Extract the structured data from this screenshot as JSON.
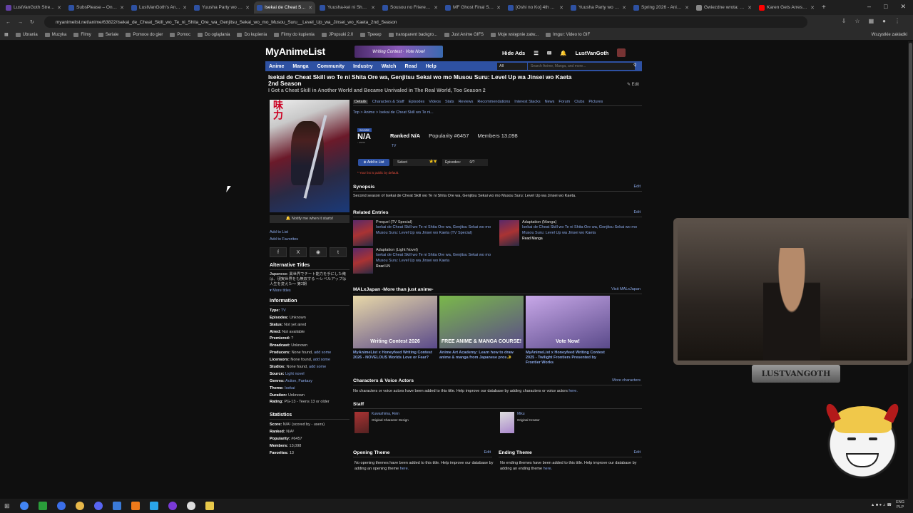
{
  "tabs": [
    {
      "label": "LustVanGoth Strea...",
      "color": "#6441a5"
    },
    {
      "label": "SubsPlease – One ...",
      "color": "#2e51a2"
    },
    {
      "label": "LustVanGoth's Ani...",
      "color": "#2e51a2"
    },
    {
      "label": "Yuusha Party wo C...",
      "color": "#2e51a2"
    },
    {
      "label": "Isekai de Cheat Skil...",
      "color": "#2e51a2",
      "active": true
    },
    {
      "label": "Yuusha-kei ni Shou...",
      "color": "#2e51a2"
    },
    {
      "label": "Sousou no Frieren ...",
      "color": "#2e51a2"
    },
    {
      "label": "MF Ghost Final Sea...",
      "color": "#2e51a2"
    },
    {
      "label": "[Oshi no Ko] 4th Se...",
      "color": "#2e51a2"
    },
    {
      "label": "Yuusha Party wo C...",
      "color": "#2e51a2"
    },
    {
      "label": "Spring 2026 - Anim...",
      "color": "#2e51a2"
    },
    {
      "label": "Gwiezdne wrota: A...",
      "color": "#888888"
    },
    {
      "label": "Karen Gets Arrested...",
      "color": "#ff0000"
    }
  ],
  "browser": {
    "url": "myanimelist.net/anime/63822/Isekai_de_Cheat_Skill_wo_Te_ni_Shita_Ore_wa_Genjitsu_Sekai_wo_mo_Musou_Suru__Level_Up_wa_Jinsei_wo_Kaeta_2nd_Season",
    "bookmarks": [
      "Ubrania",
      "Muzyka",
      "Filmy",
      "Seriale",
      "Pomoce do gier",
      "Pomoc",
      "Do oglądania",
      "Do kupienia",
      "Filmy do kupienia",
      "JPopsuki 2.0",
      "Трекер",
      "transparent backgro...",
      "Just Anime GIFS",
      "Moje wstępnie zatw...",
      "Imgur: Video to GIF"
    ],
    "bookmarks_right": "Wszystkie zakładki"
  },
  "mal": {
    "logo": "MyAnimeList",
    "banner": "Writing Contest · Vote Now!",
    "hide_ads": "Hide Ads",
    "username": "LustVanGoth",
    "nav": [
      "Anime",
      "Manga",
      "Community",
      "Industry",
      "Watch",
      "Read",
      "Help"
    ],
    "search_select": "All",
    "search_placeholder": "Search Anime, Manga, and more...",
    "title": "Isekai de Cheat Skill wo Te ni Shita Ore wa, Genjitsu Sekai wo mo Musou Suru: Level Up wa Jinsei wo Kaeta 2nd Season",
    "english_title": "I Got a Cheat Skill in Another World and Became Unrivaled in The Real World, Too Season 2",
    "edit": "Edit",
    "notify": "Notify me when it starts!",
    "add_to_list": "Add to List",
    "add_to_favorites": "Add to Favorites",
    "alt_titles_heading": "Alternative Titles",
    "japanese_label": "Japanese:",
    "japanese": "異世界でチート能力を手にした俺は、現実世界をも無双する ～レベルアップは人生を変えた～ 第2期",
    "more_titles": "More titles",
    "information_heading": "Information",
    "info": [
      {
        "k": "Type:",
        "v": "TV",
        "link": true
      },
      {
        "k": "Episodes:",
        "v": "Unknown"
      },
      {
        "k": "Status:",
        "v": "Not yet aired"
      },
      {
        "k": "Aired:",
        "v": "Not available"
      },
      {
        "k": "Premiered:",
        "v": "?"
      },
      {
        "k": "Broadcast:",
        "v": "Unknown"
      },
      {
        "k": "Producers:",
        "v": "None found,",
        "extra": "add some"
      },
      {
        "k": "Licensors:",
        "v": "None found,",
        "extra": "add some"
      },
      {
        "k": "Studios:",
        "v": "None found,",
        "extra": "add some"
      },
      {
        "k": "Source:",
        "v": "Light novel",
        "link": true
      },
      {
        "k": "Genres:",
        "v": "Action, Fantasy",
        "link": true
      },
      {
        "k": "Theme:",
        "v": "Isekai",
        "link": true
      },
      {
        "k": "Duration:",
        "v": "Unknown"
      },
      {
        "k": "Rating:",
        "v": "PG-13 - Teens 13 or older"
      }
    ],
    "statistics_heading": "Statistics",
    "statistics": [
      {
        "k": "Score:",
        "v": "N/A¹ (scored by - users)"
      },
      {
        "k": "Ranked:",
        "v": "N/A²"
      },
      {
        "k": "Popularity:",
        "v": "#6457"
      },
      {
        "k": "Members:",
        "v": "13,098"
      },
      {
        "k": "Favorites:",
        "v": "13"
      }
    ],
    "subnav": [
      "Details",
      "Characters & Staff",
      "Episodes",
      "Videos",
      "Stats",
      "Reviews",
      "Recommendations",
      "Interest Stacks",
      "News",
      "Forum",
      "Clubs",
      "Pictures"
    ],
    "breadcrumb": "Top  >  Anime  >  Isekai de Cheat Skill wo Te ni...",
    "score_label": "SCORE",
    "score": "N/A",
    "score_users": "- users",
    "ranked": "Ranked N/A",
    "popularity": "Popularity #6457",
    "members": "Members 13,098",
    "type": "TV",
    "add_button": "Add to List",
    "select": "Select",
    "episodes_label": "Episodes:",
    "episodes_value": "0/?",
    "private_note": "* Your list is public by default.",
    "synopsis_heading": "Synopsis",
    "synopsis": "Second season of Isekai de Cheat Skill wo Te ni Shita Ore wa, Genjitsu Sekai wo mo Musou Suru: Level Up wa Jinsei wo Kaeta.",
    "related_heading": "Related Entries",
    "related": [
      {
        "type": "Prequel (TV Special)",
        "title": "Isekai de Cheat Skill wo Te ni Shita Ore wa, Genjitsu Sekai wo mo Musou Suru: Level Up wa Jinsei wo Kaeta (TV Special)",
        "badge": ""
      },
      {
        "type": "Adaptation (Manga)",
        "title": "Isekai de Cheat Skill wo Te ni Shita Ore wa, Genjitsu Sekai wo mo Musou Suru: Level Up wa Jinsei wo Kaeta",
        "badge": "Read Manga"
      },
      {
        "type": "Adaptation (Light Novel)",
        "title": "Isekai de Cheat Skill wo Te ni Shita Ore wa, Genjitsu Sekai wo mo Musou Suru: Level Up wa Jinsei wo Kaeta",
        "badge": "Read LN"
      }
    ],
    "malx_heading": "MALxJapan -More than just anime-",
    "malx_link": "Visit MALxJapan",
    "cards": [
      {
        "title": "MyAnimeList x Honeyfeed Writing Contest 2026 - NOVELOUS Worlds Love or Fear?",
        "img_text": "Writing Contest 2026",
        "bg": "#e8d8a8"
      },
      {
        "title": "Anime Art Academy: Learn how to draw anime & manga from Japanese pros✨",
        "img_text": "FREE ANIME & MANGA COURSE!",
        "bg": "#7ab84a"
      },
      {
        "title": "MyAnimeList x Honeyfeed Writing Contest 2025 - Twilight Frontiers Presented by Frontier Works",
        "img_text": "Vote Now!",
        "bg": "#c8a8e8"
      }
    ],
    "characters_heading": "Characters & Voice Actors",
    "more_characters": "More characters",
    "characters_text": "No characters or voice actors have been added to this title. Help improve our database by adding characters or voice actors",
    "here": "here.",
    "staff_heading": "Staff",
    "staff": [
      {
        "name": "Kuwashima, Rein",
        "role": "Original Character Design"
      },
      {
        "name": "Miku",
        "role": "Original Creator"
      }
    ],
    "opening_heading": "Opening Theme",
    "ending_heading": "Ending Theme",
    "opening_text": "No opening themes have been added to this title. Help improve our database by adding an opening theme",
    "ending_text": "No ending themes have been added to this title. Help improve our database by adding an ending theme"
  },
  "stream": {
    "nameplate": "LUSTVANGOTH"
  },
  "tray": {
    "lang": "ENG\nPLP",
    "time": "",
    "date": ""
  }
}
